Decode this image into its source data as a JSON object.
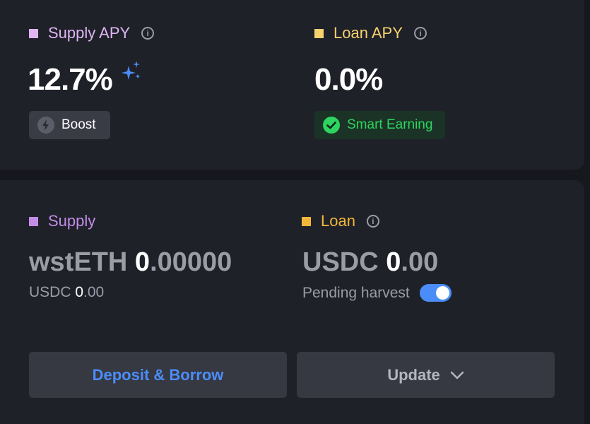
{
  "colors": {
    "supply": "#e0b5f5",
    "loan": "#f6d16e",
    "supply_bottom": "#c38de8",
    "loan_bottom": "#f2b73a",
    "smart_earning_text": "#2ed45f",
    "deposit_btn_text": "#4b8df8",
    "update_btn_text": "#b4b6bf"
  },
  "top": {
    "supply_apy": {
      "label": "Supply APY",
      "value": "12.7%",
      "boost_label": "Boost"
    },
    "loan_apy": {
      "label": "Loan APY",
      "value": "0.0%",
      "badge_label": "Smart Earning"
    }
  },
  "bottom": {
    "supply": {
      "label": "Supply",
      "token": "wstETH",
      "amount_int": "0",
      "amount_frac": ".00000",
      "sub_token": "USDC",
      "sub_int": "0",
      "sub_frac": ".00"
    },
    "loan": {
      "label": "Loan",
      "token": "USDC",
      "amount_int": "0",
      "amount_frac": ".00",
      "pending_label": "Pending harvest",
      "pending_enabled": true
    }
  },
  "actions": {
    "deposit_borrow": "Deposit & Borrow",
    "update": "Update"
  },
  "icons": [
    "info-icon",
    "sparkle-icon",
    "lightning-icon",
    "check-circle-icon",
    "chevron-down-icon"
  ]
}
